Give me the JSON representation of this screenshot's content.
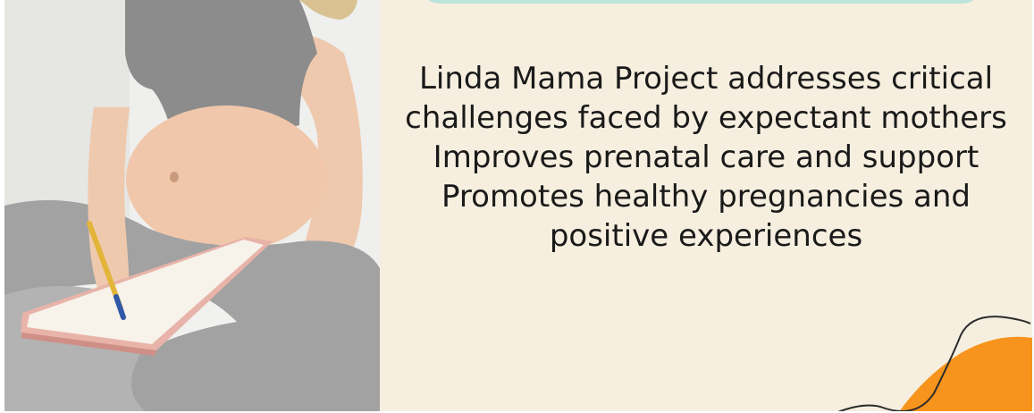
{
  "slide": {
    "body_text": "Linda Mama Project addresses critical challenges faced by expectant mothers Improves prenatal care and support Promotes healthy pregnancies and positive experiences"
  },
  "photo": {
    "subject": "pregnant woman writing in a notebook"
  },
  "colors": {
    "panel_background": "#f6efdf",
    "teal_accent": "#bde4db",
    "orange_accent": "#f7941d",
    "line_accent": "#2b2b2b",
    "text": "#1a1a1a"
  },
  "icons": {
    "decoration": "orange-blob-with-curved-line"
  }
}
